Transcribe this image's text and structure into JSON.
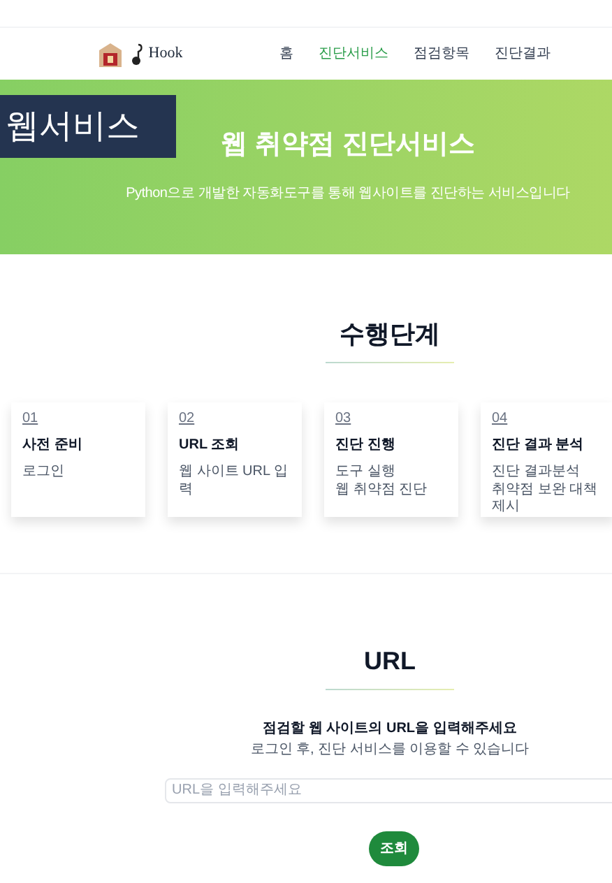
{
  "nav": {
    "logo_text": "Hook",
    "items": [
      {
        "label": "홈",
        "selected": false
      },
      {
        "label": "진단서비스",
        "selected": true
      },
      {
        "label": "점검항목",
        "selected": false
      },
      {
        "label": "진단결과",
        "selected": false
      }
    ]
  },
  "caption_overlay": "웹서비스",
  "hero": {
    "title": "웹 취약점 진단서비스",
    "subtitle": "Python으로 개발한 자동화도구를 통해 웹사이트를 진단하는 서비스입니다"
  },
  "steps": {
    "heading": "수행단계",
    "items": [
      {
        "number": "01",
        "title": "사전 준비",
        "lines": [
          "로그인"
        ]
      },
      {
        "number": "02",
        "title": "URL 조회",
        "lines": [
          "웹 사이트 URL 입력"
        ]
      },
      {
        "number": "03",
        "title": "진단 진행",
        "lines": [
          "도구 실행",
          "웹 취약점 진단"
        ]
      },
      {
        "number": "04",
        "title": "진단 결과 분석",
        "lines": [
          "진단 결과분석",
          "취약점 보완 대책 제시"
        ]
      }
    ]
  },
  "url_section": {
    "heading": "URL",
    "prompt": "점검할 웹 사이트의 URL을 입력해주세요",
    "note": "로그인 후, 진단 서비스를 이용할 수 있습니다",
    "placeholder": "URL을 입력해주세요",
    "button": "조회"
  }
}
